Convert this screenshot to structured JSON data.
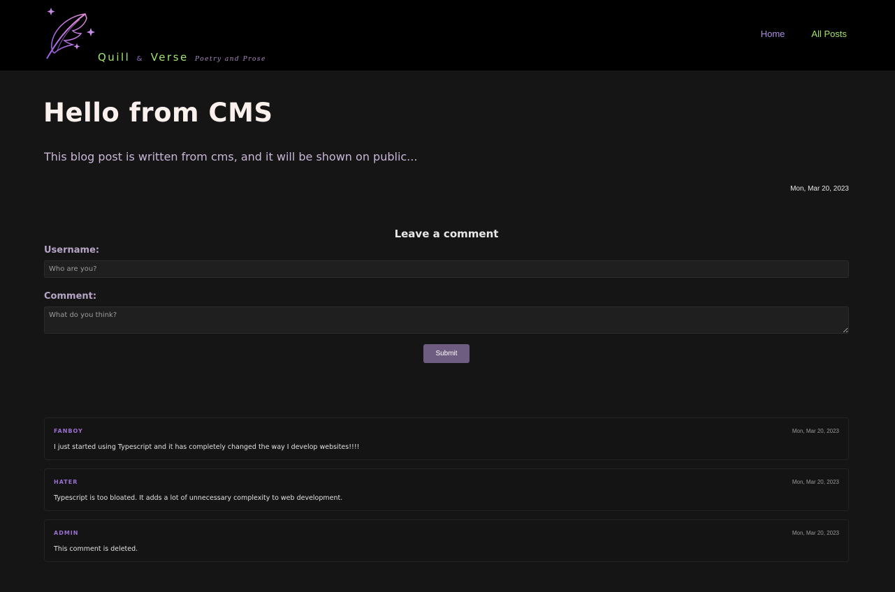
{
  "header": {
    "brand": {
      "word1": "Quill",
      "amp": "&",
      "word2": "Verse",
      "tagline": "Poetry and Prose",
      "logo_icon": "quill-feather-sparkles-icon"
    },
    "nav": {
      "home_label": "Home",
      "all_posts_label": "All Posts"
    }
  },
  "post": {
    "title": "Hello from CMS",
    "excerpt": "This blog post is written from cms, and it will be shown on public...",
    "date": "Mon, Mar 20, 2023"
  },
  "comment_form": {
    "title": "Leave a comment",
    "username_label": "Username:",
    "username_placeholder": "Who are you?",
    "comment_label": "Comment:",
    "comment_placeholder": "What do you think?",
    "submit_label": "Submit"
  },
  "comments": [
    {
      "author": "FANBOY",
      "date": "Mon, Mar 20, 2023",
      "body": "I just started using Typescript and it has completely changed the way I develop websites!!!!"
    },
    {
      "author": "HATER",
      "date": "Mon, Mar 20, 2023",
      "body": "Typescript is too bloated. It adds a lot of unnecessary complexity to web development."
    },
    {
      "author": "ADMIN",
      "date": "Mon, Mar 20, 2023",
      "body": "This comment is deleted."
    }
  ],
  "colors": {
    "background": "#151515",
    "header_bg": "#000000",
    "brand_green": "#9fe870",
    "accent_purple": "#9b6fd0",
    "button": "#6e5d80"
  }
}
